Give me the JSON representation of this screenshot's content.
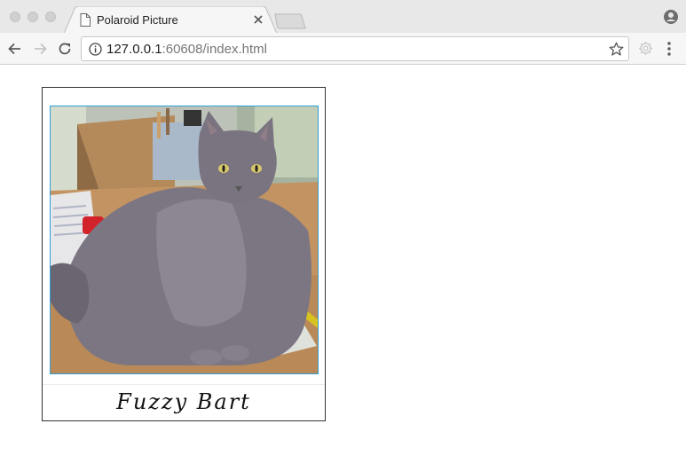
{
  "browser": {
    "tab": {
      "title": "Polaroid Picture",
      "icon": "page-icon"
    },
    "address": {
      "host": "127.0.0.1",
      "rest": ":60608/index.html"
    }
  },
  "polaroid": {
    "caption": "Fuzzy Bart",
    "photo_subject": "long-haired grey cat sitting on wooden desk",
    "frame_color": "#2f9fd8"
  }
}
